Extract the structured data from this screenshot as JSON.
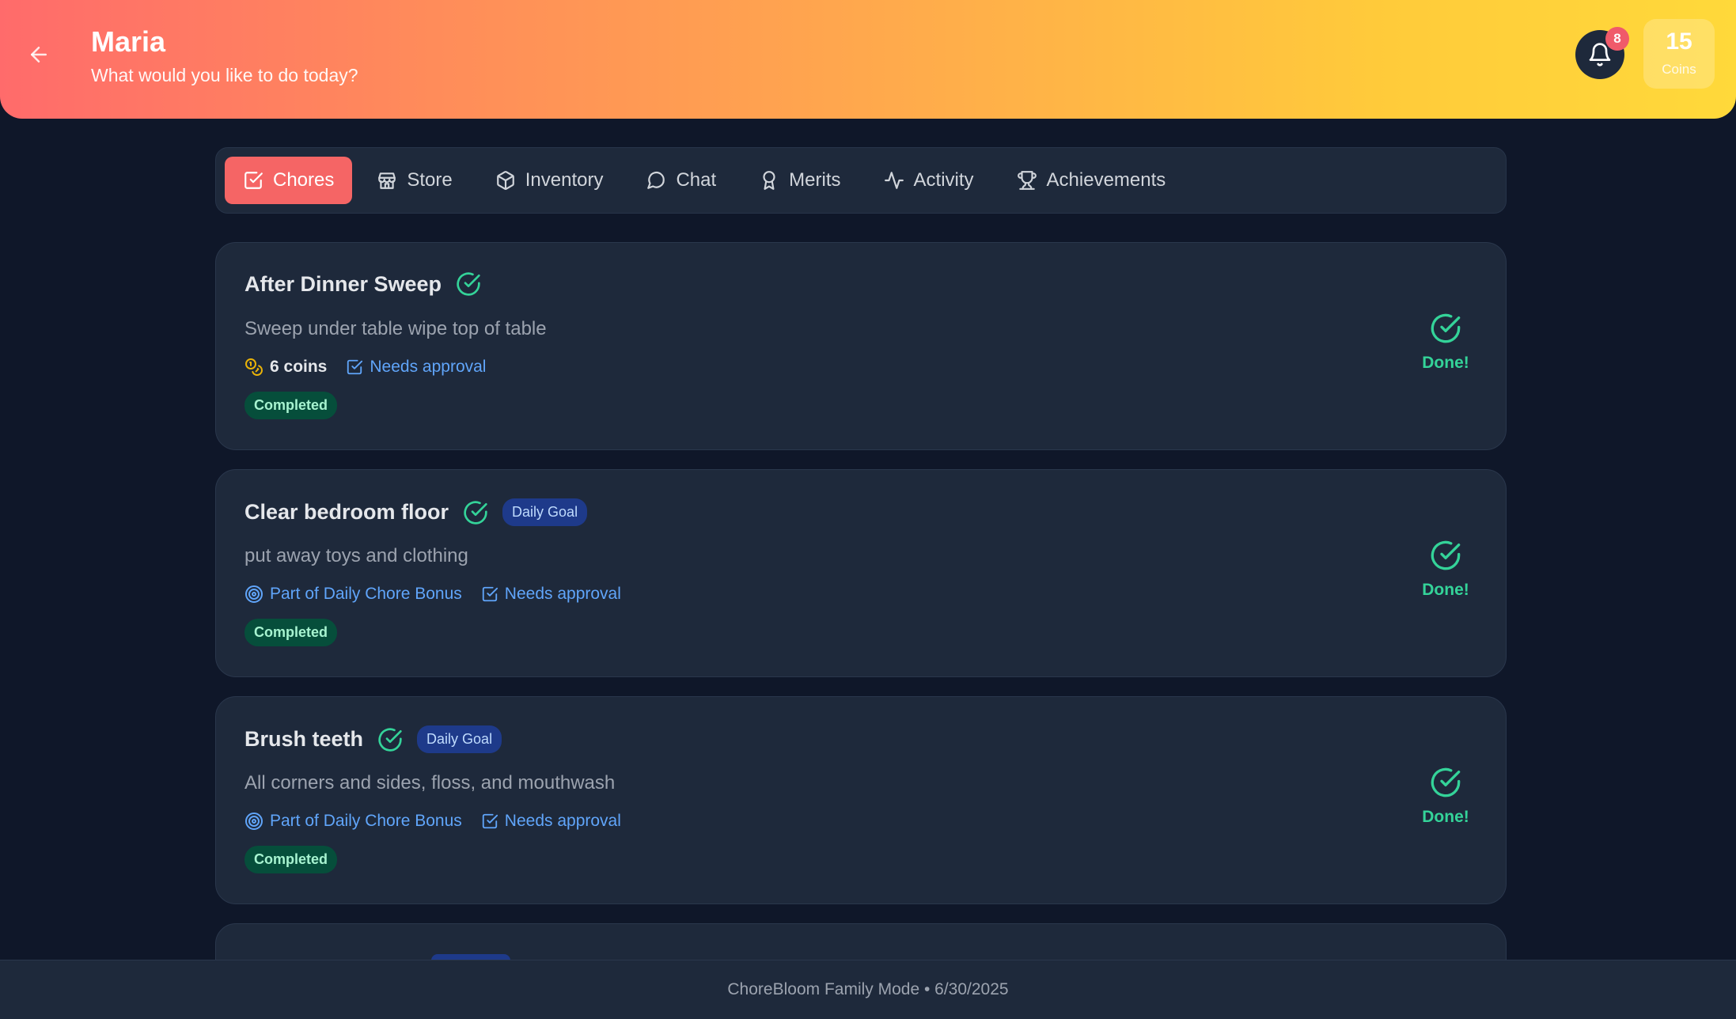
{
  "header": {
    "name": "Maria",
    "subtitle": "What would you like to do today?",
    "notifications": "8",
    "coins_value": "15",
    "coins_label": "Coins"
  },
  "tabs": [
    {
      "label": "Chores",
      "icon": "checkbox-icon",
      "active": true
    },
    {
      "label": "Store",
      "icon": "store-icon"
    },
    {
      "label": "Inventory",
      "icon": "box-icon"
    },
    {
      "label": "Chat",
      "icon": "chat-bubble-icon"
    },
    {
      "label": "Merits",
      "icon": "ribbon-icon"
    },
    {
      "label": "Activity",
      "icon": "activity-icon"
    },
    {
      "label": "Achievements",
      "icon": "trophy-icon"
    }
  ],
  "chores": [
    {
      "title": "After Dinner Sweep",
      "description": "Sweep under table wipe top of table",
      "coins": "6 coins",
      "approval": "Needs approval",
      "status": "Completed",
      "done_label": "Done!"
    },
    {
      "title": "Clear bedroom floor",
      "goal_badge": "Daily Goal",
      "description": "put away toys and clothing",
      "bonus": "Part of Daily Chore Bonus",
      "approval": "Needs approval",
      "status": "Completed",
      "done_label": "Done!"
    },
    {
      "title": "Brush teeth",
      "goal_badge": "Daily Goal",
      "description": "All corners and sides, floss, and mouthwash",
      "bonus": "Part of Daily Chore Bonus",
      "approval": "Needs approval",
      "status": "Completed",
      "done_label": "Done!"
    }
  ],
  "footer": {
    "text": "ChoreBloom Family Mode • 6/30/2025"
  },
  "colors": {
    "accent": "#f56565",
    "done": "#34d399",
    "link": "#60a5fa",
    "background": "#0f1729"
  }
}
